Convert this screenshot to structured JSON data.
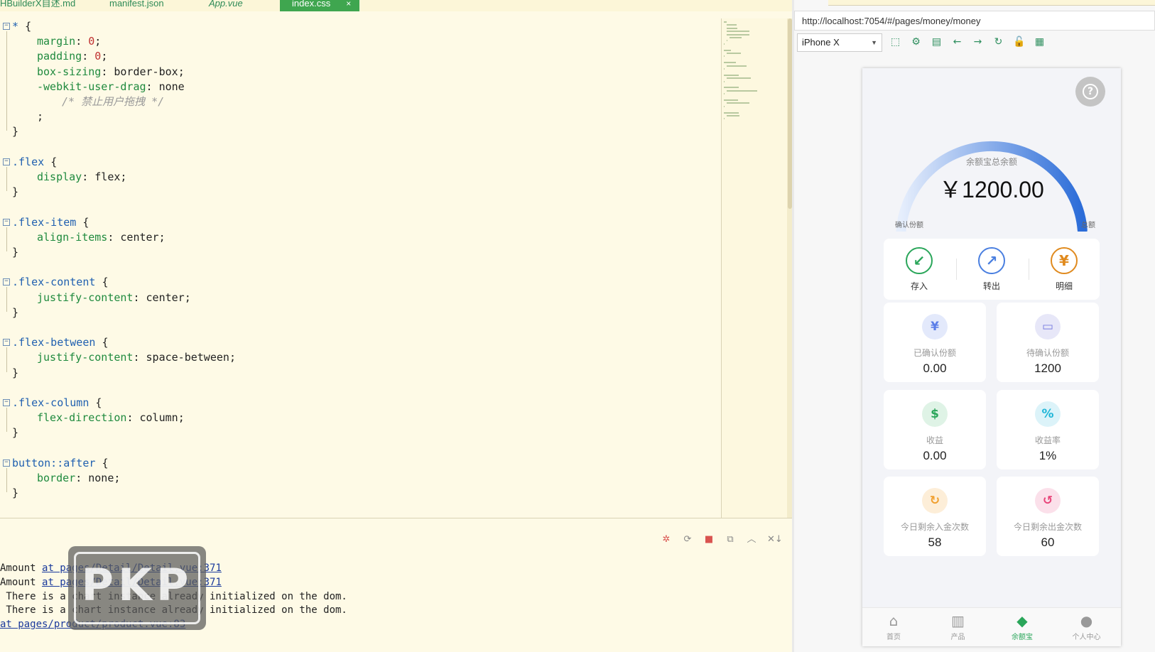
{
  "editor": {
    "tabs": [
      {
        "label": "HBuilderX自述.md",
        "style": "normal"
      },
      {
        "label": "manifest.json",
        "style": "normal"
      },
      {
        "label": "App.vue",
        "style": "italic"
      },
      {
        "label": "index.css",
        "style": "active"
      }
    ],
    "tab_close_glyph": "×",
    "code_lines": [
      {
        "fold": true,
        "parts": [
          {
            "t": "* ",
            "c": "sel"
          },
          {
            "t": "{",
            "c": "pun"
          }
        ]
      },
      {
        "indent": 1,
        "parts": [
          {
            "t": "margin",
            "c": "prop"
          },
          {
            "t": ": ",
            "c": "pun"
          },
          {
            "t": "0",
            "c": "num"
          },
          {
            "t": ";",
            "c": "pun"
          }
        ]
      },
      {
        "indent": 1,
        "parts": [
          {
            "t": "padding",
            "c": "prop"
          },
          {
            "t": ": ",
            "c": "pun"
          },
          {
            "t": "0",
            "c": "num"
          },
          {
            "t": ";",
            "c": "pun"
          }
        ]
      },
      {
        "indent": 1,
        "parts": [
          {
            "t": "box-sizing",
            "c": "prop"
          },
          {
            "t": ": ",
            "c": "pun"
          },
          {
            "t": "border-box",
            "c": "val"
          },
          {
            "t": ";",
            "c": "pun"
          }
        ]
      },
      {
        "indent": 1,
        "parts": [
          {
            "t": "-webkit-user-drag",
            "c": "prop"
          },
          {
            "t": ": ",
            "c": "pun"
          },
          {
            "t": "none",
            "c": "val"
          }
        ]
      },
      {
        "indent": 2,
        "parts": [
          {
            "t": "/* 禁止用户拖拽 */",
            "c": "cmt"
          }
        ]
      },
      {
        "indent": 1,
        "parts": [
          {
            "t": ";",
            "c": "pun"
          }
        ]
      },
      {
        "parts": [
          {
            "t": "}",
            "c": "pun"
          }
        ]
      },
      {
        "parts": []
      },
      {
        "fold": true,
        "parts": [
          {
            "t": ".flex ",
            "c": "sel"
          },
          {
            "t": "{",
            "c": "pun"
          }
        ]
      },
      {
        "indent": 1,
        "parts": [
          {
            "t": "display",
            "c": "prop"
          },
          {
            "t": ": ",
            "c": "pun"
          },
          {
            "t": "flex",
            "c": "val"
          },
          {
            "t": ";",
            "c": "pun"
          }
        ]
      },
      {
        "parts": [
          {
            "t": "}",
            "c": "pun"
          }
        ]
      },
      {
        "parts": []
      },
      {
        "fold": true,
        "parts": [
          {
            "t": ".flex-item ",
            "c": "sel"
          },
          {
            "t": "{",
            "c": "pun"
          }
        ]
      },
      {
        "indent": 1,
        "parts": [
          {
            "t": "align-items",
            "c": "prop"
          },
          {
            "t": ": ",
            "c": "pun"
          },
          {
            "t": "center",
            "c": "val"
          },
          {
            "t": ";",
            "c": "pun"
          }
        ]
      },
      {
        "parts": [
          {
            "t": "}",
            "c": "pun"
          }
        ]
      },
      {
        "parts": []
      },
      {
        "fold": true,
        "parts": [
          {
            "t": ".flex-content ",
            "c": "sel"
          },
          {
            "t": "{",
            "c": "pun"
          }
        ]
      },
      {
        "indent": 1,
        "parts": [
          {
            "t": "justify-content",
            "c": "prop"
          },
          {
            "t": ": ",
            "c": "pun"
          },
          {
            "t": "center",
            "c": "val"
          },
          {
            "t": ";",
            "c": "pun"
          }
        ]
      },
      {
        "parts": [
          {
            "t": "}",
            "c": "pun"
          }
        ]
      },
      {
        "parts": []
      },
      {
        "fold": true,
        "parts": [
          {
            "t": ".flex-between ",
            "c": "sel"
          },
          {
            "t": "{",
            "c": "pun"
          }
        ]
      },
      {
        "indent": 1,
        "parts": [
          {
            "t": "justify-content",
            "c": "prop"
          },
          {
            "t": ": ",
            "c": "pun"
          },
          {
            "t": "space-between",
            "c": "val"
          },
          {
            "t": ";",
            "c": "pun"
          }
        ]
      },
      {
        "parts": [
          {
            "t": "}",
            "c": "pun"
          }
        ]
      },
      {
        "parts": []
      },
      {
        "fold": true,
        "parts": [
          {
            "t": ".flex-column ",
            "c": "sel"
          },
          {
            "t": "{",
            "c": "pun"
          }
        ]
      },
      {
        "indent": 1,
        "parts": [
          {
            "t": "flex-direction",
            "c": "prop"
          },
          {
            "t": ": ",
            "c": "pun"
          },
          {
            "t": "column",
            "c": "val"
          },
          {
            "t": ";",
            "c": "pun"
          }
        ]
      },
      {
        "parts": [
          {
            "t": "}",
            "c": "pun"
          }
        ]
      },
      {
        "parts": []
      },
      {
        "fold": true,
        "parts": [
          {
            "t": "button::after ",
            "c": "sel"
          },
          {
            "t": "{",
            "c": "pun"
          }
        ]
      },
      {
        "indent": 1,
        "parts": [
          {
            "t": "border",
            "c": "prop"
          },
          {
            "t": ": ",
            "c": "pun"
          },
          {
            "t": "none",
            "c": "val"
          },
          {
            "t": ";",
            "c": "pun"
          }
        ]
      },
      {
        "parts": [
          {
            "t": "}",
            "c": "pun"
          }
        ]
      }
    ],
    "fold_glyph": "−",
    "colors": {
      "selector": "#2060b0",
      "property": "#1f8a3e",
      "number": "#c03030",
      "comment": "#9a9a9a",
      "active_tab": "#3fa64f",
      "editor_bg": "#fefae6"
    }
  },
  "console": {
    "tools": [
      {
        "name": "bug-icon",
        "glyph": "✲",
        "color": "red"
      },
      {
        "name": "rerun-icon",
        "glyph": "⟳",
        "color": ""
      },
      {
        "name": "stop-icon",
        "glyph": "■",
        "color": "red"
      },
      {
        "name": "open-log-icon",
        "glyph": "⧉",
        "color": ""
      },
      {
        "name": "collapse-icon",
        "glyph": "︿",
        "color": ""
      },
      {
        "name": "clear-icon",
        "glyph": "✕↓",
        "color": ""
      }
    ],
    "logs": [
      {
        "prefix": "Amount ",
        "link": "at pages/Detail/Detail.vue:371"
      },
      {
        "prefix": "Amount ",
        "link": "at pages/Detail/Detail.vue:371"
      },
      {
        "prefix": " There is a chart instance already initialized on the dom.",
        "link": ""
      },
      {
        "prefix": " There is a chart instance already initialized on the dom.",
        "link": ""
      },
      {
        "prefix": "",
        "link": "at pages/product/product.vue:83"
      }
    ],
    "watermark": "PKP"
  },
  "browser": {
    "url": "http://localhost:7054/#/pages/money/money",
    "device": "iPhone X",
    "toolbar_icons": [
      {
        "name": "screenshot-icon",
        "glyph": "⬚"
      },
      {
        "name": "settings-icon",
        "glyph": "⚙"
      },
      {
        "name": "devtools-icon",
        "glyph": "▤"
      },
      {
        "name": "back-icon",
        "glyph": "←"
      },
      {
        "name": "forward-icon",
        "glyph": "→"
      },
      {
        "name": "refresh-icon",
        "glyph": "↻"
      },
      {
        "name": "lock-icon",
        "glyph": "🔓"
      },
      {
        "name": "qrcode-icon",
        "glyph": "▦"
      }
    ]
  },
  "app": {
    "help_glyph": "?",
    "gauge": {
      "label": "余额宝总余额",
      "amount": "￥1200.00",
      "left_label": "确认份额",
      "right_label": "总额",
      "fill_fraction": 1.0,
      "color_start": "#e6eefc",
      "color_end": "#2b6cd8"
    },
    "actions": [
      {
        "label": "存入",
        "glyph": "↙",
        "color": "#2aa65a"
      },
      {
        "label": "转出",
        "glyph": "↗",
        "color": "#4a7fe0"
      },
      {
        "label": "明细",
        "glyph": "¥",
        "color": "#e08a1e"
      }
    ],
    "cards": [
      {
        "label": "已确认份额",
        "value": "0.00",
        "glyph": "¥",
        "fg": "#5b7ee8",
        "bg": "#e3e9fb"
      },
      {
        "label": "待确认份额",
        "value": "1200",
        "glyph": "▭",
        "fg": "#7a7ee0",
        "bg": "#e7e7f8"
      },
      {
        "label": "收益",
        "value": "0.00",
        "glyph": "$",
        "fg": "#2aa65a",
        "bg": "#dff3e6"
      },
      {
        "label": "收益率",
        "value": "1%",
        "glyph": "%",
        "fg": "#1fb6d8",
        "bg": "#dcf3f9"
      },
      {
        "label": "今日剩余入金次数",
        "value": "58",
        "glyph": "↻",
        "fg": "#f0a030",
        "bg": "#fdeed8"
      },
      {
        "label": "今日剩余出金次数",
        "value": "60",
        "glyph": "↺",
        "fg": "#e8457a",
        "bg": "#fbe0ea"
      }
    ],
    "nav": [
      {
        "label": "首页",
        "glyph": "⌂",
        "active": false
      },
      {
        "label": "产品",
        "glyph": "▥",
        "active": false
      },
      {
        "label": "余额宝",
        "glyph": "◆",
        "active": true
      },
      {
        "label": "个人中心",
        "glyph": "●",
        "active": false
      }
    ]
  }
}
